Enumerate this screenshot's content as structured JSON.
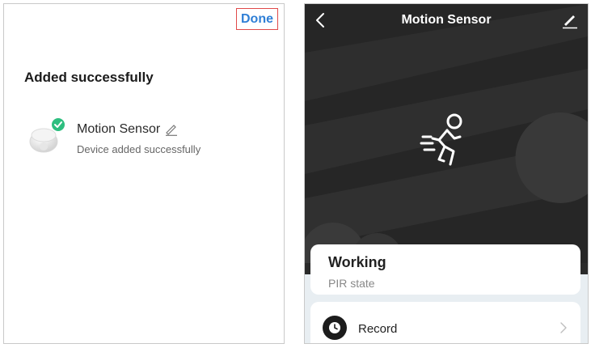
{
  "left": {
    "done_label": "Done",
    "title": "Added successfully",
    "device": {
      "name": "Motion Sensor",
      "status": "Device added successfully",
      "check_color": "#2dbe7f"
    },
    "accent_color": "#2f7fd6"
  },
  "right": {
    "nav_title": "Motion Sensor",
    "status": {
      "value": "Working",
      "label": "PIR state"
    },
    "record_label": "Record"
  },
  "icons": {
    "back": "chevron-left-icon",
    "edit": "pencil-icon",
    "runner": "running-person-icon",
    "record": "clock-icon",
    "chevron": "chevron-right-icon",
    "check": "check-badge-icon"
  }
}
